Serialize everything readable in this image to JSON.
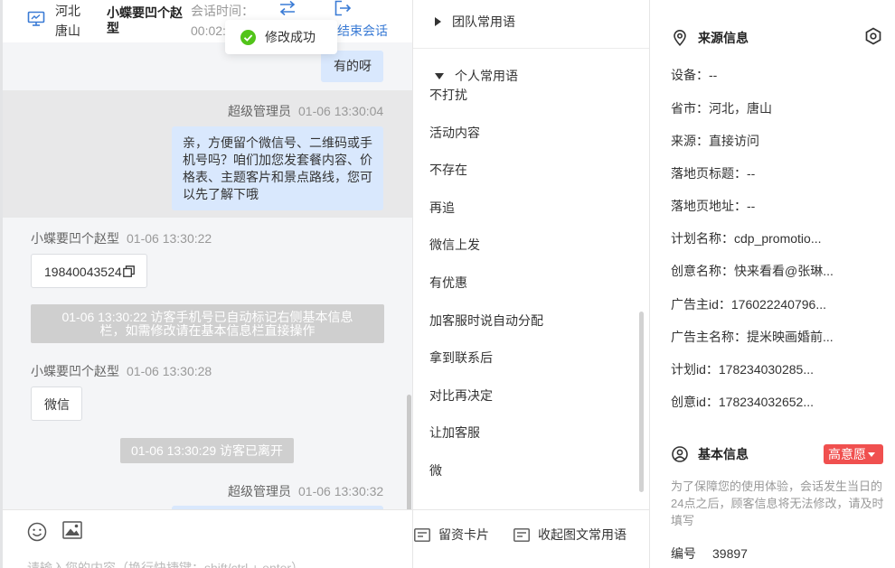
{
  "header": {
    "location": "河北 唐山",
    "visitor_name": "小蝶要凹个赵型",
    "session_label": "会话时间：",
    "session_time": "00:02:",
    "end_session": "结束会话"
  },
  "toast": {
    "message": "修改成功"
  },
  "messages": {
    "m1_text": "有的呀",
    "m2_sender": "超级管理员",
    "m2_time": "01-06 13:30:04",
    "m2_text": "亲，方便留个微信号、二维码或手机号吗？咱们加您发套餐内容、价格表、主题客片和景点路线，您可以先了解下哦",
    "m3_sender": "小蝶要凹个赵型",
    "m3_time": "01-06 13:30:22",
    "m3_text": "19840043524",
    "sys1": "01-06 13:30:22 访客手机号已自动标记右侧基本信息栏，如需修改请在基本信息栏直接操作",
    "m4_sender": "小蝶要凹个赵型",
    "m4_time": "01-06 13:30:28",
    "m4_text": "微信",
    "sys2": "01-06 13:30:29 访客已离开",
    "m5_sender": "超级管理员",
    "m5_time": "01-06 13:30:32"
  },
  "input": {
    "placeholder": "请输入您的内容（换行快捷键：shift/ctrl + enter）"
  },
  "phrases": {
    "team_title": "团队常用语",
    "personal_title": "个人常用语",
    "items": [
      "不打扰",
      "活动内容",
      "不存在",
      "再追",
      "微信上发",
      "有优惠",
      "加客服时说自动分配",
      "拿到联系后",
      "对比再决定",
      "让加客服",
      "微"
    ],
    "btn_card": "留资卡片",
    "btn_collapse": "收起图文常用语"
  },
  "source_info": {
    "title": "来源信息",
    "rows": [
      "设备：--",
      "省市：河北，唐山",
      "来源：直接访问",
      "落地页标题：--",
      "落地页地址：--",
      "计划名称：cdp_promotio...",
      "创意名称：快来看看@张琳...",
      "广告主id：176022240796...",
      "广告主名称：提米映画婚前...",
      "计划id：178234030285...",
      "创意id：178234032652..."
    ]
  },
  "basic_info": {
    "title": "基本信息",
    "intent": "高意愿",
    "notice": "为了保障您的使用体验，会话发生当日的24点之后，顾客信息将无法修改，请及时填写",
    "id_label": "编号",
    "id_value": "39897"
  },
  "colors": {
    "accent": "#3a7bd5",
    "bubble": "#d9e8fd",
    "success": "#52c41a",
    "badge": "#f0504f"
  }
}
